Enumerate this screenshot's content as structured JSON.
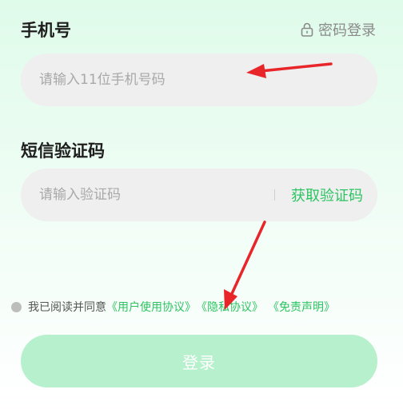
{
  "phone": {
    "label": "手机号",
    "placeholder": "请输入11位手机号码"
  },
  "password_login": {
    "icon": "lock-icon",
    "label": "密码登录"
  },
  "code": {
    "label": "短信验证码",
    "placeholder": "请输入验证码",
    "get_code_label": "获取验证码"
  },
  "agreement": {
    "text": "我已阅读并同意",
    "user_agreement": "《用户使用协议》",
    "privacy": "《隐私协议》",
    "disclaimer": "《免责声明》"
  },
  "login": {
    "label": "登录"
  },
  "colors": {
    "accent": "#2cc462",
    "button_disabled": "#b7f0cc",
    "annotation_arrow": "#e8262a"
  }
}
